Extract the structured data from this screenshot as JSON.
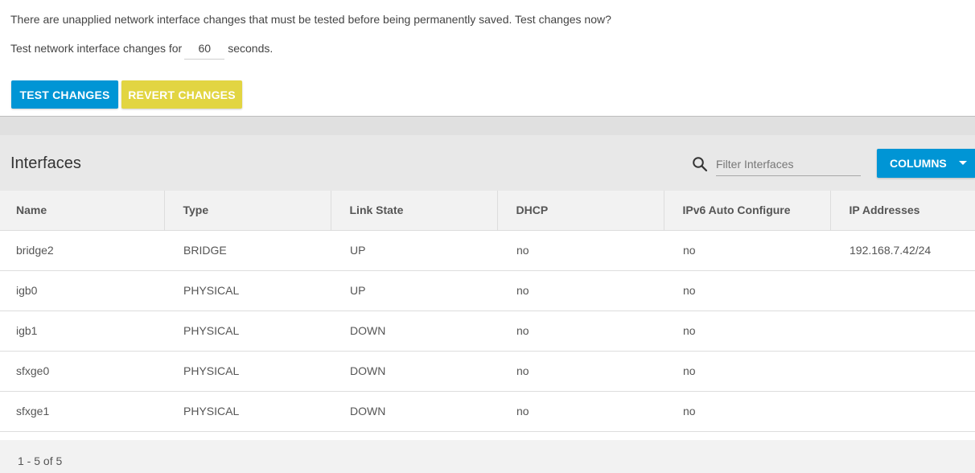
{
  "notice": {
    "message": "There are unapplied network interface changes that must be tested before being permanently saved. Test changes now?",
    "timer_prefix": "Test network interface changes for",
    "timer_value": "60",
    "timer_suffix": "seconds."
  },
  "actions": {
    "test_label": "TEST CHANGES",
    "revert_label": "REVERT CHANGES"
  },
  "card": {
    "title": "Interfaces",
    "filter_placeholder": "Filter Interfaces",
    "columns_label": "COLUMNS"
  },
  "table": {
    "headers": [
      "Name",
      "Type",
      "Link State",
      "DHCP",
      "IPv6 Auto Configure",
      "IP Addresses"
    ],
    "rows": [
      [
        "bridge2",
        "BRIDGE",
        "UP",
        "no",
        "no",
        "192.168.7.42/24"
      ],
      [
        "igb0",
        "PHYSICAL",
        "UP",
        "no",
        "no",
        ""
      ],
      [
        "igb1",
        "PHYSICAL",
        "DOWN",
        "no",
        "no",
        ""
      ],
      [
        "sfxge0",
        "PHYSICAL",
        "DOWN",
        "no",
        "no",
        ""
      ],
      [
        "sfxge1",
        "PHYSICAL",
        "DOWN",
        "no",
        "no",
        ""
      ]
    ]
  },
  "footer": {
    "range": "1 - 5 of 5"
  },
  "colors": {
    "primary": "#0095d5",
    "warning": "#e2d542"
  },
  "icons": {
    "search": "search-icon",
    "dropdown": "caret-down-icon"
  }
}
